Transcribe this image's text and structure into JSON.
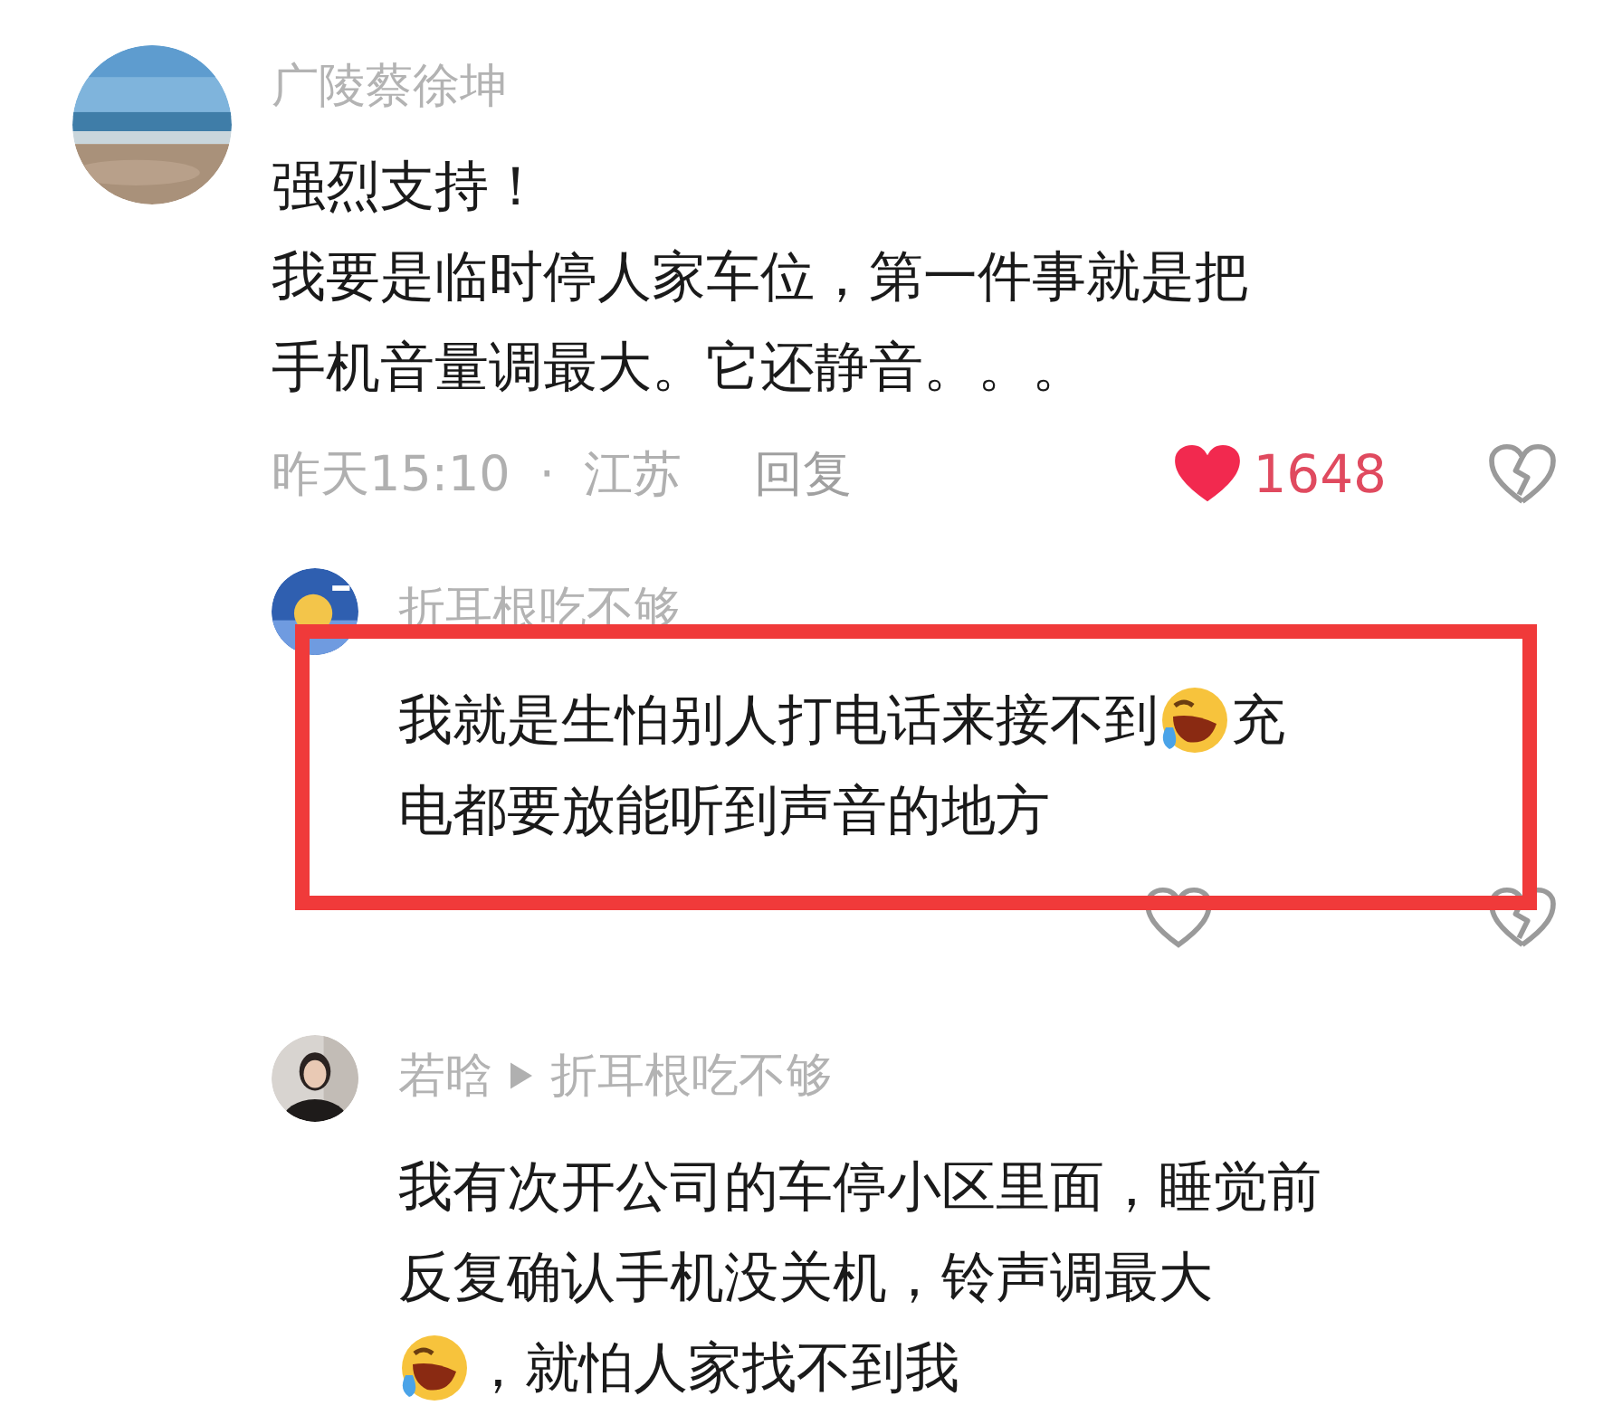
{
  "comments": [
    {
      "author": "广陵蔡徐坤",
      "avatar": {
        "kind": "picture"
      },
      "lines": [
        [
          {
            "kind": "text",
            "text": "强烈支持！"
          }
        ],
        [
          {
            "kind": "text",
            "text": "我要是临时停人家车位，第一件事就是把"
          }
        ],
        [
          {
            "kind": "text",
            "text": "手机音量调最大。它还静音。。。"
          }
        ]
      ],
      "time": "昨天15:10",
      "separator": "·",
      "location": "江苏",
      "reply": "回复",
      "likes": "1648",
      "liked": true,
      "replies": [
        {
          "author": "折耳根吃不够",
          "avatar": {
            "kind": "picture"
          },
          "highlighted": true,
          "lines": [
            [
              {
                "kind": "text",
                "text": "我就是生怕别人打电话来接不到"
              },
              {
                "kind": "emoji"
              },
              {
                "kind": "text",
                "text": "充"
              }
            ],
            [
              {
                "kind": "text",
                "text": "电都要放能听到声音的地方"
              }
            ]
          ],
          "liked": false
        },
        {
          "author": "若晗",
          "reply_to": "折耳根吃不够",
          "avatar": {
            "kind": "picture"
          },
          "lines": [
            [
              {
                "kind": "text",
                "text": "我有次开公司的车停小区里面，睡觉前"
              }
            ],
            [
              {
                "kind": "text",
                "text": "反复确认手机没关机，铃声调最大"
              }
            ],
            [
              {
                "kind": "emoji"
              },
              {
                "kind": "text",
                "text": "，就怕人家找不到我"
              }
            ]
          ]
        }
      ]
    }
  ]
}
